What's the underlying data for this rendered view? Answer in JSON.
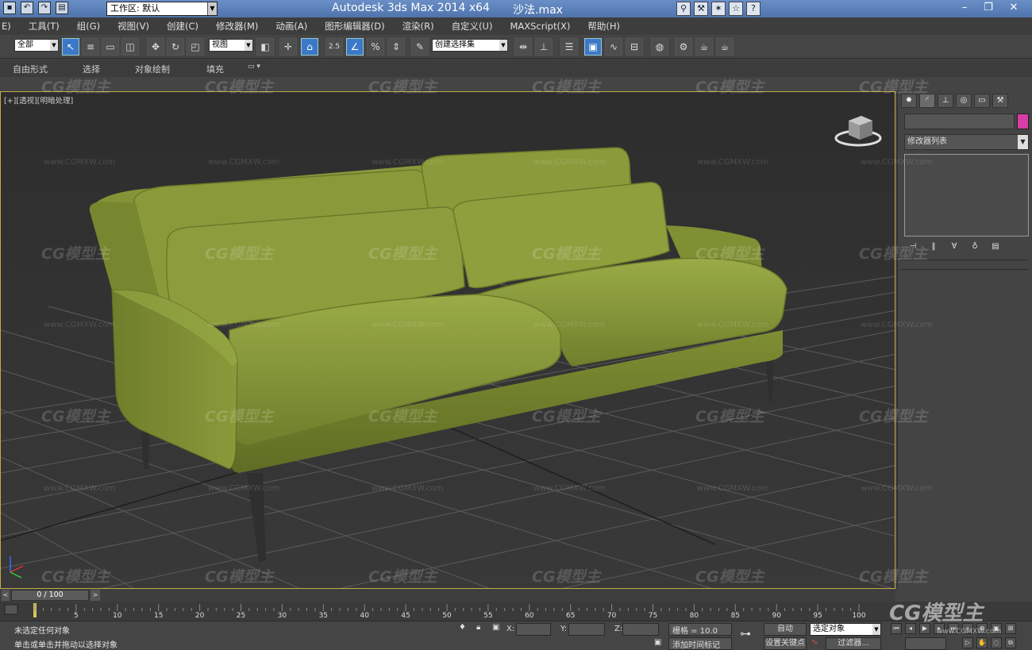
{
  "titlebar": {
    "workspace_label": "工作区: 默认",
    "app_title": "Autodesk 3ds Max  2014 x64",
    "file_name": "沙法.max"
  },
  "menu": [
    "E)",
    "工具(T)",
    "组(G)",
    "视图(V)",
    "创建(C)",
    "修改器(M)",
    "动画(A)",
    "图形编辑器(D)",
    "渲染(R)",
    "自定义(U)",
    "MAXScript(X)",
    "帮助(H)"
  ],
  "toolbar": {
    "selection_filter": "全部",
    "reference_coord": "视图",
    "named_selection": "创建选择集",
    "snap_angle_label": "2.5"
  },
  "ribbon": {
    "tabs": [
      "自由形式",
      "选择",
      "对象绘制",
      "填充"
    ]
  },
  "viewport": {
    "label": "[+][透视][明暗处理]",
    "object": "sofa",
    "sofa_color": "#8a9a3a"
  },
  "command_panel": {
    "object_color": "#d63ea3",
    "modifier_list_label": "修改器列表"
  },
  "timeline": {
    "frame_counter": "0 / 100",
    "ticks": [
      "5",
      "10",
      "15",
      "20",
      "25",
      "30",
      "35",
      "40",
      "45",
      "50",
      "55",
      "60",
      "65",
      "70",
      "75",
      "80",
      "85",
      "90",
      "95",
      "100"
    ]
  },
  "status": {
    "selection_msg": "未选定任何对象",
    "prompt_msg": "单击或单击并拖动以选择对象",
    "x_label": "X:",
    "y_label": "Y:",
    "z_label": "Z:",
    "grid_label": "栅格 = 10.0",
    "add_time_tag": "添加时间标记",
    "auto_key": "自动",
    "set_key": "设置关键点",
    "key_filter_value": "选定对象",
    "filters_label": "过滤器..."
  },
  "watermark": {
    "logo": "CG模型主",
    "url": "www.CGMXW.com"
  }
}
